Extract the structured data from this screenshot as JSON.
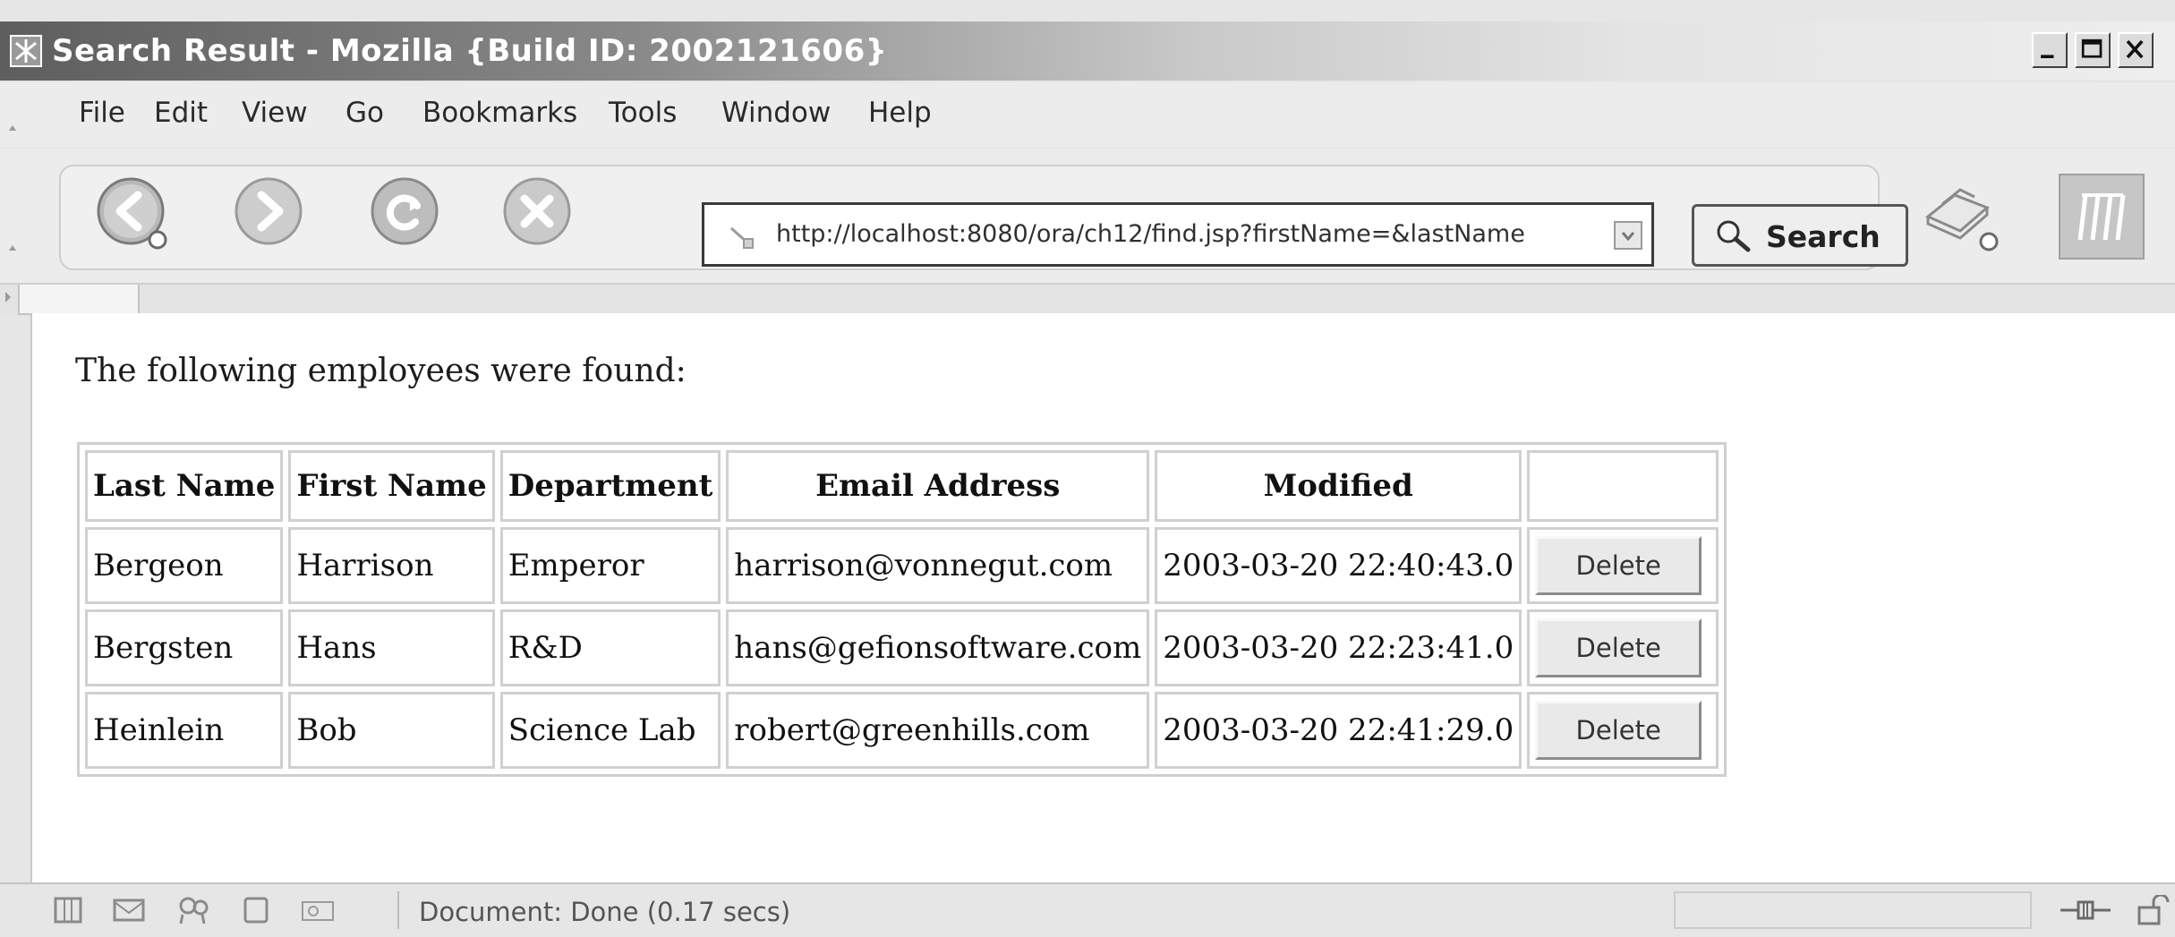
{
  "window": {
    "title": "Search Result - Mozilla {Build ID: 2002121606}"
  },
  "menubar": {
    "items": [
      {
        "label": "File"
      },
      {
        "label": "Edit"
      },
      {
        "label": "View"
      },
      {
        "label": "Go"
      },
      {
        "label": "Bookmarks"
      },
      {
        "label": "Tools"
      },
      {
        "label": "Window"
      },
      {
        "label": "Help"
      }
    ]
  },
  "toolbar": {
    "back_icon": "back-arrow-icon",
    "forward_icon": "forward-arrow-icon",
    "reload_icon": "reload-icon",
    "stop_icon": "stop-icon",
    "url": "http://localhost:8080/ora/ch12/find.jsp?firstName=&lastName",
    "search_label": "Search",
    "print_icon": "print-icon",
    "throbber_icon": "mozilla-throbber-icon"
  },
  "page": {
    "intro": "The following employees were found:",
    "columns": [
      "Last Name",
      "First Name",
      "Department",
      "Email Address",
      "Modified",
      ""
    ],
    "rows": [
      {
        "last": "Bergeon",
        "first": "Harrison",
        "dept": "Emperor",
        "email": "harrison@vonnegut.com",
        "modified": "2003-03-20 22:40:43.0",
        "action": "Delete"
      },
      {
        "last": "Bergsten",
        "first": "Hans",
        "dept": "R&D",
        "email": "hans@gefionsoftware.com",
        "modified": "2003-03-20 22:23:41.0",
        "action": "Delete"
      },
      {
        "last": "Heinlein",
        "first": "Bob",
        "dept": "Science Lab",
        "email": "robert@greenhills.com",
        "modified": "2003-03-20 22:41:29.0",
        "action": "Delete"
      }
    ]
  },
  "statusbar": {
    "text": "Document: Done (0.17 secs)"
  }
}
